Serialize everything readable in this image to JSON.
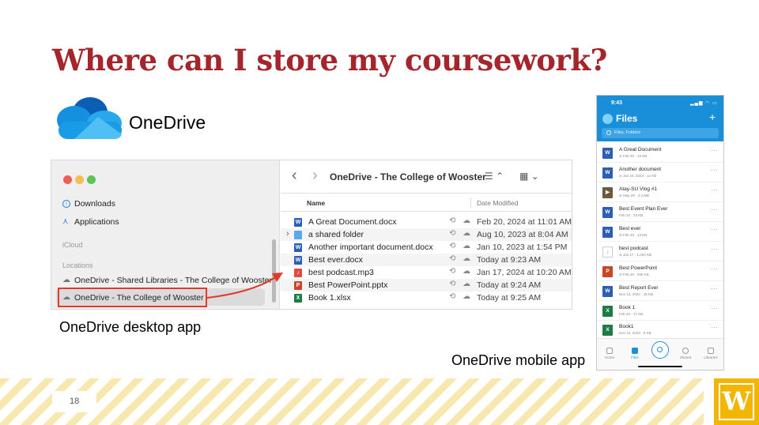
{
  "slide": {
    "title": "Where can I store my coursework?",
    "brand_label": "OneDrive",
    "caption_desktop": "OneDrive desktop app",
    "caption_mobile": "OneDrive mobile app",
    "page_number": "18",
    "logo_letter": "W",
    "colors": {
      "title": "#a4262c",
      "highlight": "#e03a2b",
      "stripe": "#f7e8b0",
      "logo": "#f2b600"
    }
  },
  "desktop": {
    "sidebar": {
      "items": [
        {
          "label": "Downloads",
          "icon": "download-icon"
        },
        {
          "label": "Applications",
          "icon": "applications-icon"
        }
      ],
      "section_icloud": "iCloud",
      "section_locations": "Locations",
      "locations": [
        {
          "label": "OneDrive - Shared Libraries - The College of Wooster",
          "icon": "cloud-icon"
        },
        {
          "label": "OneDrive - The College of Wooster",
          "icon": "cloud-icon",
          "selected": true
        }
      ]
    },
    "toolbar": {
      "back": "‹",
      "forward": "›",
      "title": "OneDrive - The College of Wooster",
      "view_label": "☰ ⌃",
      "group_label": "▦ ⌄"
    },
    "columns": {
      "name": "Name",
      "date": "Date Modified"
    },
    "files": [
      {
        "name": "A Great Document.docx",
        "date": "Feb 20, 2024 at 11:01 AM",
        "type": "word"
      },
      {
        "name": "a shared folder",
        "date": "Aug 10, 2023 at 8:04 AM",
        "type": "folder"
      },
      {
        "name": "Another important document.docx",
        "date": "Jan 10, 2023 at 1:54 PM",
        "type": "word"
      },
      {
        "name": "Best ever.docx",
        "date": "Today at 9:23 AM",
        "type": "word"
      },
      {
        "name": "best podcast.mp3",
        "date": "Jan 17, 2024 at 10:20 AM",
        "type": "audio"
      },
      {
        "name": "Best PowerPoint.pptx",
        "date": "Today at 9:24 AM",
        "type": "ppt"
      },
      {
        "name": "Book 1.xlsx",
        "date": "Today at 9:25 AM",
        "type": "excel"
      }
    ]
  },
  "mobile": {
    "time": "9:43",
    "status": "▂▄▆ ◠ ▭",
    "title": "Files",
    "add": "+",
    "search_placeholder": "Files, Folders",
    "files": [
      {
        "name": "A Great Document",
        "meta": "⊘ Feb 20 · 13 KB",
        "type": "word"
      },
      {
        "name": "Another document",
        "meta": "⊘ Jan 10, 2023 · 12 KB",
        "type": "word"
      },
      {
        "name": "Atay-SU Vlog #1",
        "meta": "⊘ May 29 · 3.3 MB",
        "type": "video"
      },
      {
        "name": "Best Event Plan Ever",
        "meta": "Feb 20 · 33 KB",
        "type": "word"
      },
      {
        "name": "Best ever",
        "meta": "⊘ Feb 20 · 13 KB",
        "type": "word"
      },
      {
        "name": "best podcast",
        "meta": "⊘ Jan 17 · 1,003 KB",
        "type": "audio"
      },
      {
        "name": "Best PowerPoint",
        "meta": "⊘ Feb 20 · 930 KB",
        "type": "ppt"
      },
      {
        "name": "Best Report Ever",
        "meta": "Nov 14, 2023 · 45 KB",
        "type": "word"
      },
      {
        "name": "Book 1",
        "meta": "Feb 20 · 17 KB",
        "type": "excel"
      },
      {
        "name": "Book1",
        "meta": "Dec 12, 2023 · 8 KB",
        "type": "excel"
      }
    ],
    "tabs": [
      {
        "label": "Home",
        "icon": "home-icon"
      },
      {
        "label": "Files",
        "icon": "folder-icon",
        "active": true
      },
      {
        "label": "Shared",
        "icon": "shared-icon"
      },
      {
        "label": "Libraries",
        "icon": "libraries-icon"
      }
    ]
  }
}
